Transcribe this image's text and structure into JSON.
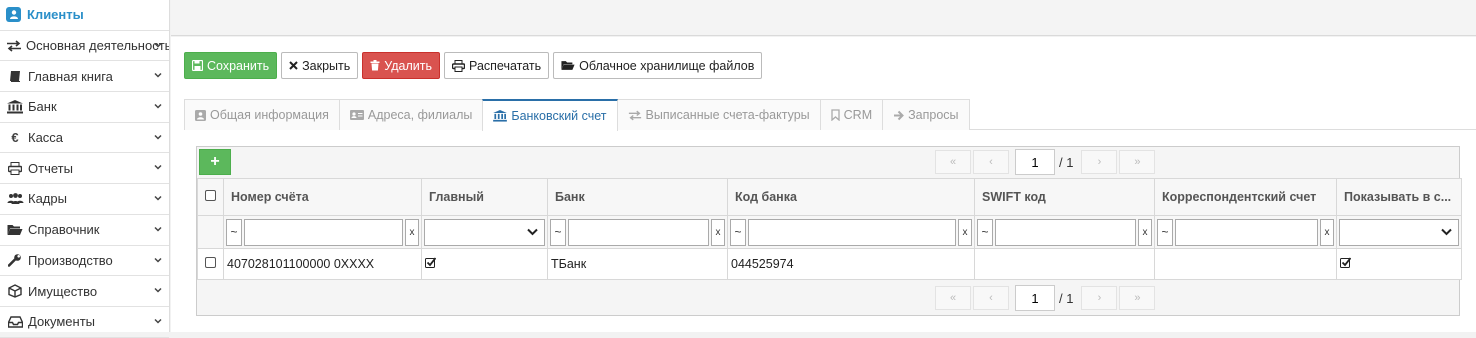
{
  "sidebar": {
    "items": [
      {
        "label": "Клиенты",
        "icon": "user-badge-icon"
      },
      {
        "label": "Основная деятельность",
        "icon": "exchange-icon"
      },
      {
        "label": "Главная книга",
        "icon": "book-icon"
      },
      {
        "label": "Банк",
        "icon": "bank-icon"
      },
      {
        "label": "Касса",
        "icon": "euro-icon"
      },
      {
        "label": "Отчеты",
        "icon": "print-icon"
      },
      {
        "label": "Кадры",
        "icon": "users-icon"
      },
      {
        "label": "Справочник",
        "icon": "folder-open-icon"
      },
      {
        "label": "Производство",
        "icon": "wrench-icon"
      },
      {
        "label": "Имущество",
        "icon": "cube-icon"
      },
      {
        "label": "Документы",
        "icon": "inbox-icon"
      }
    ]
  },
  "toolbar": {
    "save_label": "Сохранить",
    "close_label": "Закрыть",
    "delete_label": "Удалить",
    "print_label": "Распечатать",
    "cloud_label": "Облачное хранилище файлов"
  },
  "tabs": [
    {
      "label": "Общая информация",
      "icon": "id-card-icon"
    },
    {
      "label": "Адреса, филиалы",
      "icon": "address-card-icon"
    },
    {
      "label": "Банковский счет",
      "icon": "bank-icon",
      "active": true
    },
    {
      "label": "Выписанные счета-фактуры",
      "icon": "exchange-icon"
    },
    {
      "label": "CRM",
      "icon": "bookmark-icon"
    },
    {
      "label": "Запросы",
      "icon": "arrow-right-icon"
    }
  ],
  "grid": {
    "add_label": "+",
    "pager": {
      "first": "«",
      "prev": "‹",
      "page": "1",
      "total": "/ 1",
      "next": "›",
      "last": "»"
    },
    "columns": [
      "Номер счёта",
      "Главный",
      "Банк",
      "Код банка",
      "SWIFT код",
      "Корреспондентский счет",
      "Показывать в с..."
    ],
    "filter_op": "~",
    "filter_clear": "x",
    "rows": [
      {
        "account": "407028101100000 0XXXX",
        "main": true,
        "bank": "ТБанк",
        "bank_code": "044525974",
        "swift": "",
        "corr": "",
        "show": true
      }
    ]
  },
  "colors": {
    "accent": "#2a8fc9",
    "save": "#5cb85c",
    "delete": "#d9534f",
    "active_tab": "#2a6fa8"
  }
}
